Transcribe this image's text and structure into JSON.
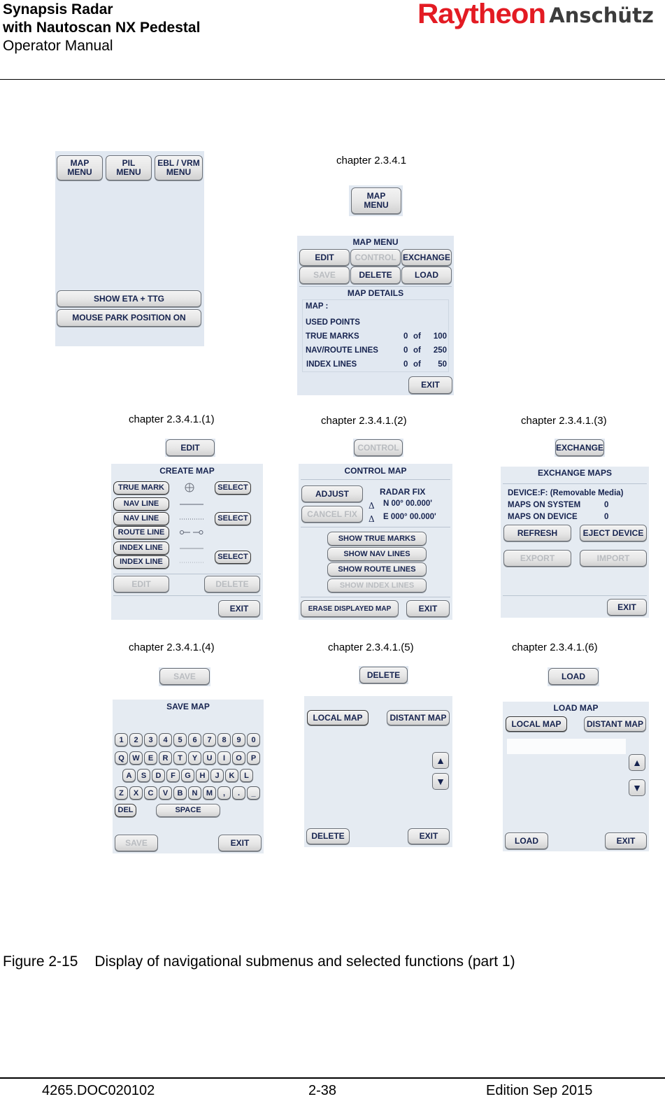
{
  "header": {
    "title_line1": "Synapsis Radar",
    "title_line2": "with Nautoscan NX Pedestal",
    "subtitle": "Operator Manual",
    "logo_brand": "Raytheon",
    "logo_company": "Anschütz",
    "brand_color": "#e31b23"
  },
  "main_panel": {
    "buttons": [
      {
        "label_line1": "MAP",
        "label_line2": "MENU"
      },
      {
        "label_line1": "PIL",
        "label_line2": "MENU"
      },
      {
        "label_line1": "EBL / VRM",
        "label_line2": "MENU"
      }
    ],
    "show_eta_ttg": "SHOW ETA + TTG",
    "mouse_park": "MOUSE PARK POSITION ON"
  },
  "map_menu_section": {
    "caption": "chapter 2.3.4.1",
    "trigger": {
      "label_line1": "MAP",
      "label_line2": "MENU"
    },
    "title": "MAP MENU",
    "buttons": {
      "edit": "EDIT",
      "control": "CONTROL",
      "exchange": "EXCHANGE",
      "save": "SAVE",
      "delete": "DELETE",
      "load": "LOAD"
    },
    "details_title": "MAP DETAILS",
    "map_label": "MAP :",
    "used_points": "USED POINTS",
    "rows": [
      {
        "label": "TRUE MARKS",
        "used": "0",
        "of": "of",
        "max": "100"
      },
      {
        "label": "NAV/ROUTE LINES",
        "used": "0",
        "of": "of",
        "max": "250"
      },
      {
        "label": "INDEX LINES",
        "used": "0",
        "of": "of",
        "max": "50"
      }
    ],
    "exit": "EXIT"
  },
  "create_map": {
    "caption": "chapter 2.3.4.1.(1)",
    "trigger": "EDIT",
    "title": "CREATE MAP",
    "items": [
      {
        "label": "TRUE MARK",
        "symbol": "crosshair-circle"
      },
      {
        "label": "NAV LINE",
        "symbol": "solid-line"
      },
      {
        "label": "NAV LINE",
        "symbol": "dotted-line"
      },
      {
        "label": "ROUTE LINE",
        "symbol": "route-line"
      },
      {
        "label": "INDEX LINE",
        "symbol": "thin-line"
      },
      {
        "label": "INDEX LINE",
        "symbol": "faint-dotted-line"
      }
    ],
    "select": "SELECT",
    "edit": "EDIT",
    "delete": "DELETE",
    "exit": "EXIT"
  },
  "control_map": {
    "caption": "chapter 2.3.4.1.(2)",
    "trigger": "CONTROL",
    "title": "CONTROL MAP",
    "adjust": "ADJUST",
    "cancel_fix": "CANCEL FIX",
    "radar_fix": "RADAR FIX",
    "delta": "Δ",
    "lat": "N 00° 00.000'",
    "lon": "E 000° 00.000'",
    "show_true_marks": "SHOW TRUE MARKS",
    "show_nav_lines": "SHOW NAV LINES",
    "show_route_lines": "SHOW ROUTE LINES",
    "show_index_lines": "SHOW INDEX LINES",
    "erase": "ERASE DISPLAYED MAP",
    "exit": "EXIT"
  },
  "exchange_maps": {
    "caption": "chapter 2.3.4.1.(3)",
    "trigger": "EXCHANGE",
    "title": "EXCHANGE MAPS",
    "device": "DEVICE:F: (Removable Media)",
    "maps_on_system_label": "MAPS ON SYSTEM",
    "maps_on_system": "0",
    "maps_on_device_label": "MAPS ON DEVICE",
    "maps_on_device": "0",
    "refresh": "REFRESH",
    "eject": "EJECT DEVICE",
    "export": "EXPORT",
    "import": "IMPORT",
    "exit": "EXIT"
  },
  "save_map": {
    "caption": "chapter 2.3.4.1.(4)",
    "trigger": "SAVE",
    "title": "SAVE MAP",
    "rows": [
      [
        "1",
        "2",
        "3",
        "4",
        "5",
        "6",
        "7",
        "8",
        "9",
        "0"
      ],
      [
        "Q",
        "W",
        "E",
        "R",
        "T",
        "Y",
        "U",
        "I",
        "O",
        "P"
      ],
      [
        "A",
        "S",
        "D",
        "F",
        "G",
        "H",
        "J",
        "K",
        "L"
      ],
      [
        "Z",
        "X",
        "C",
        "V",
        "B",
        "N",
        "M",
        ",",
        ".",
        "_"
      ]
    ],
    "del": "DEL",
    "space": "SPACE",
    "save": "SAVE",
    "exit": "EXIT"
  },
  "delete_map": {
    "caption": "chapter 2.3.4.1.(5)",
    "trigger": "DELETE",
    "local": "LOCAL MAP",
    "distant": "DISTANT MAP",
    "up": "▲",
    "down": "▼",
    "delete": "DELETE",
    "exit": "EXIT"
  },
  "load_map": {
    "caption": "chapter 2.3.4.1.(6)",
    "trigger": "LOAD",
    "title": "LOAD MAP",
    "local": "LOCAL MAP",
    "distant": "DISTANT MAP",
    "up": "▲",
    "down": "▼",
    "load": "LOAD",
    "exit": "EXIT"
  },
  "figure_caption": {
    "number": "Figure 2-15",
    "text": "Display of navigational submenus and selected functions (part 1)"
  },
  "footer": {
    "doc_id": "4265.DOC020102",
    "page": "2-38",
    "edition": "Edition Sep 2015"
  }
}
